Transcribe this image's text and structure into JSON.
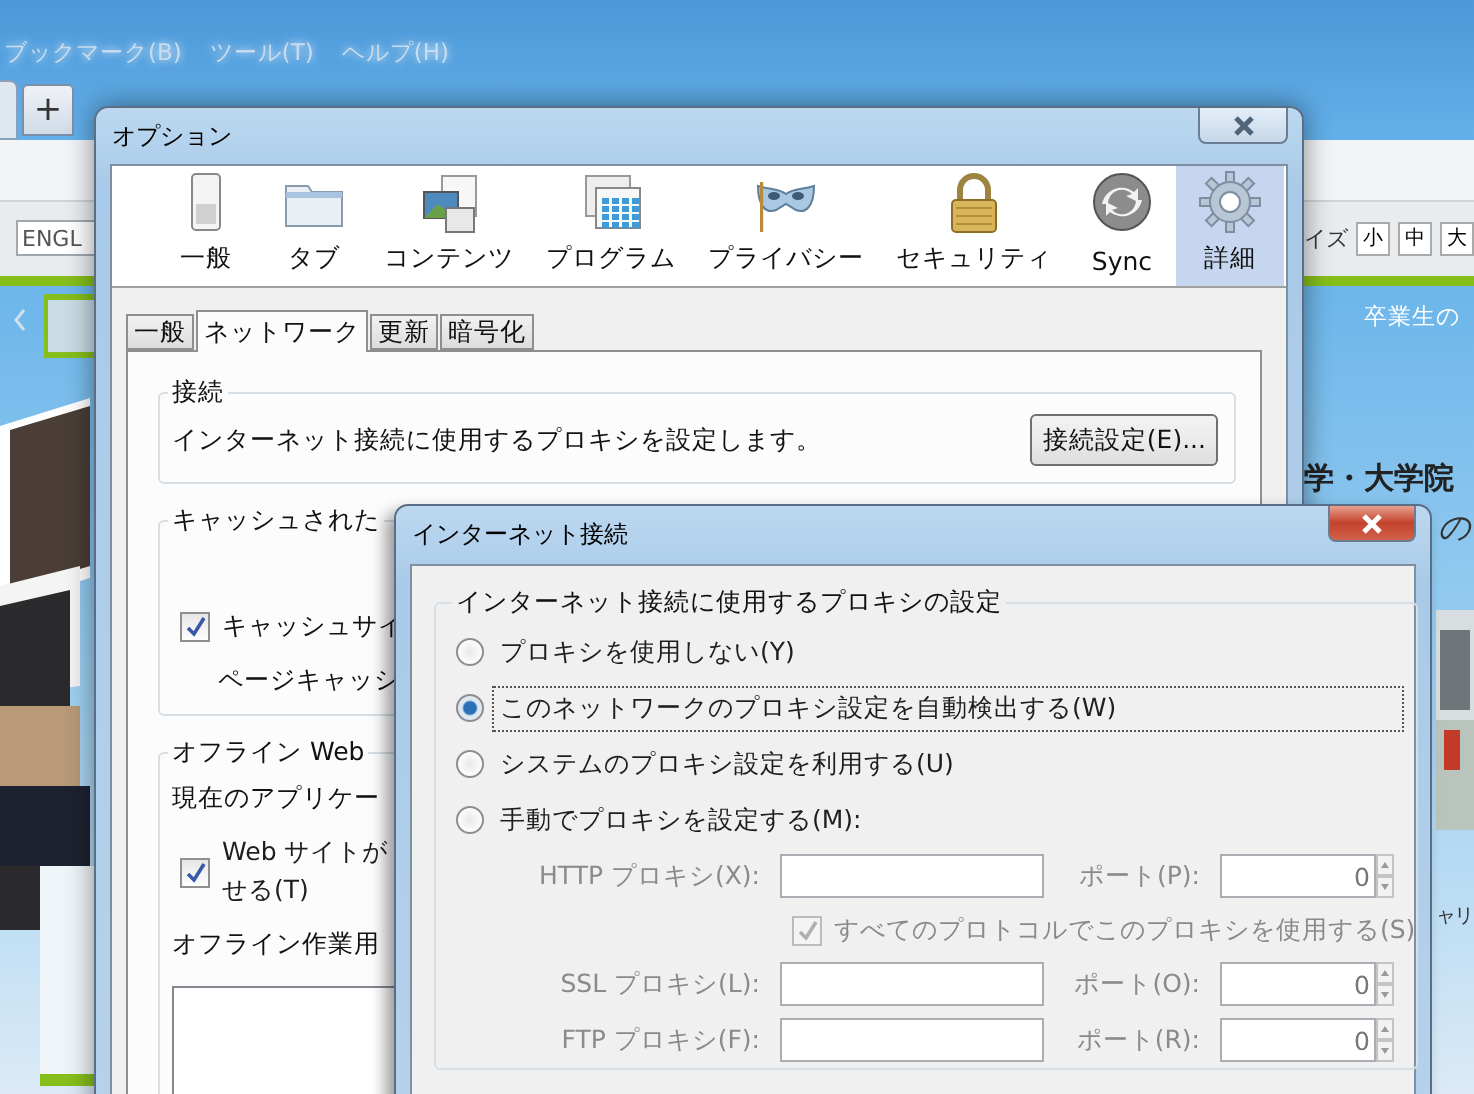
{
  "browser": {
    "menu": [
      "ブックマーク(B)",
      "ツール(T)",
      "ヘルプ(H)"
    ],
    "new_tab": "+",
    "search_value": "ENGL",
    "font_size_label": "イズ",
    "font_sizes": [
      "小",
      "中",
      "大"
    ],
    "nav_link": "卒業生の",
    "heading": "学・大学院",
    "script_text": "の",
    "side_text": "ャリ"
  },
  "options_window": {
    "title": "オプション",
    "toolbar": [
      {
        "label": "一般",
        "selected": false
      },
      {
        "label": "タブ",
        "selected": false
      },
      {
        "label": "コンテンツ",
        "selected": false
      },
      {
        "label": "プログラム",
        "selected": false
      },
      {
        "label": "プライバシー",
        "selected": false
      },
      {
        "label": "セキュリティ",
        "selected": false
      },
      {
        "label": "Sync",
        "selected": false
      },
      {
        "label": "詳細",
        "selected": true
      }
    ],
    "tabs": [
      {
        "label": "一般",
        "selected": false
      },
      {
        "label": "ネットワーク",
        "selected": true
      },
      {
        "label": "更新",
        "selected": false
      },
      {
        "label": "暗号化",
        "selected": false
      }
    ],
    "connection": {
      "legend": "接続",
      "text": "インターネット接続に使用するプロキシを設定します。",
      "button": "接続設定(E)..."
    },
    "cache": {
      "legend": "キャッシュされた",
      "checkbox": {
        "label": "キャッシュサイ",
        "checked": true
      },
      "text": "ページキャッシ"
    },
    "offline": {
      "legend": "オフライン Web",
      "text": "現在のアプリケー",
      "checkbox": {
        "lines": [
          "Web サイトが",
          "せる(T)"
        ],
        "checked": true
      },
      "list_label": "オフライン作業用"
    }
  },
  "connection_dialog": {
    "title": "インターネット接続",
    "legend": "インターネット接続に使用するプロキシの設定",
    "options": [
      {
        "label": "プロキシを使用しない(Y)",
        "selected": false
      },
      {
        "label": "このネットワークのプロキシ設定を自動検出する(W)",
        "selected": true
      },
      {
        "label": "システムのプロキシ設定を利用する(U)",
        "selected": false
      },
      {
        "label": "手動でプロキシを設定する(M):",
        "selected": false
      }
    ],
    "proxies": [
      {
        "label": "HTTP プロキシ(X):",
        "port_label": "ポート(P):",
        "port": "0"
      },
      {
        "label": "SSL プロキシ(L):",
        "port_label": "ポート(O):",
        "port": "0"
      },
      {
        "label": "FTP プロキシ(F):",
        "port_label": "ポート(R):",
        "port": "0"
      }
    ],
    "share_all": {
      "label": "すべてのプロトコルでこのプロキシを使用する(S)",
      "checked": true,
      "disabled": true
    }
  }
}
